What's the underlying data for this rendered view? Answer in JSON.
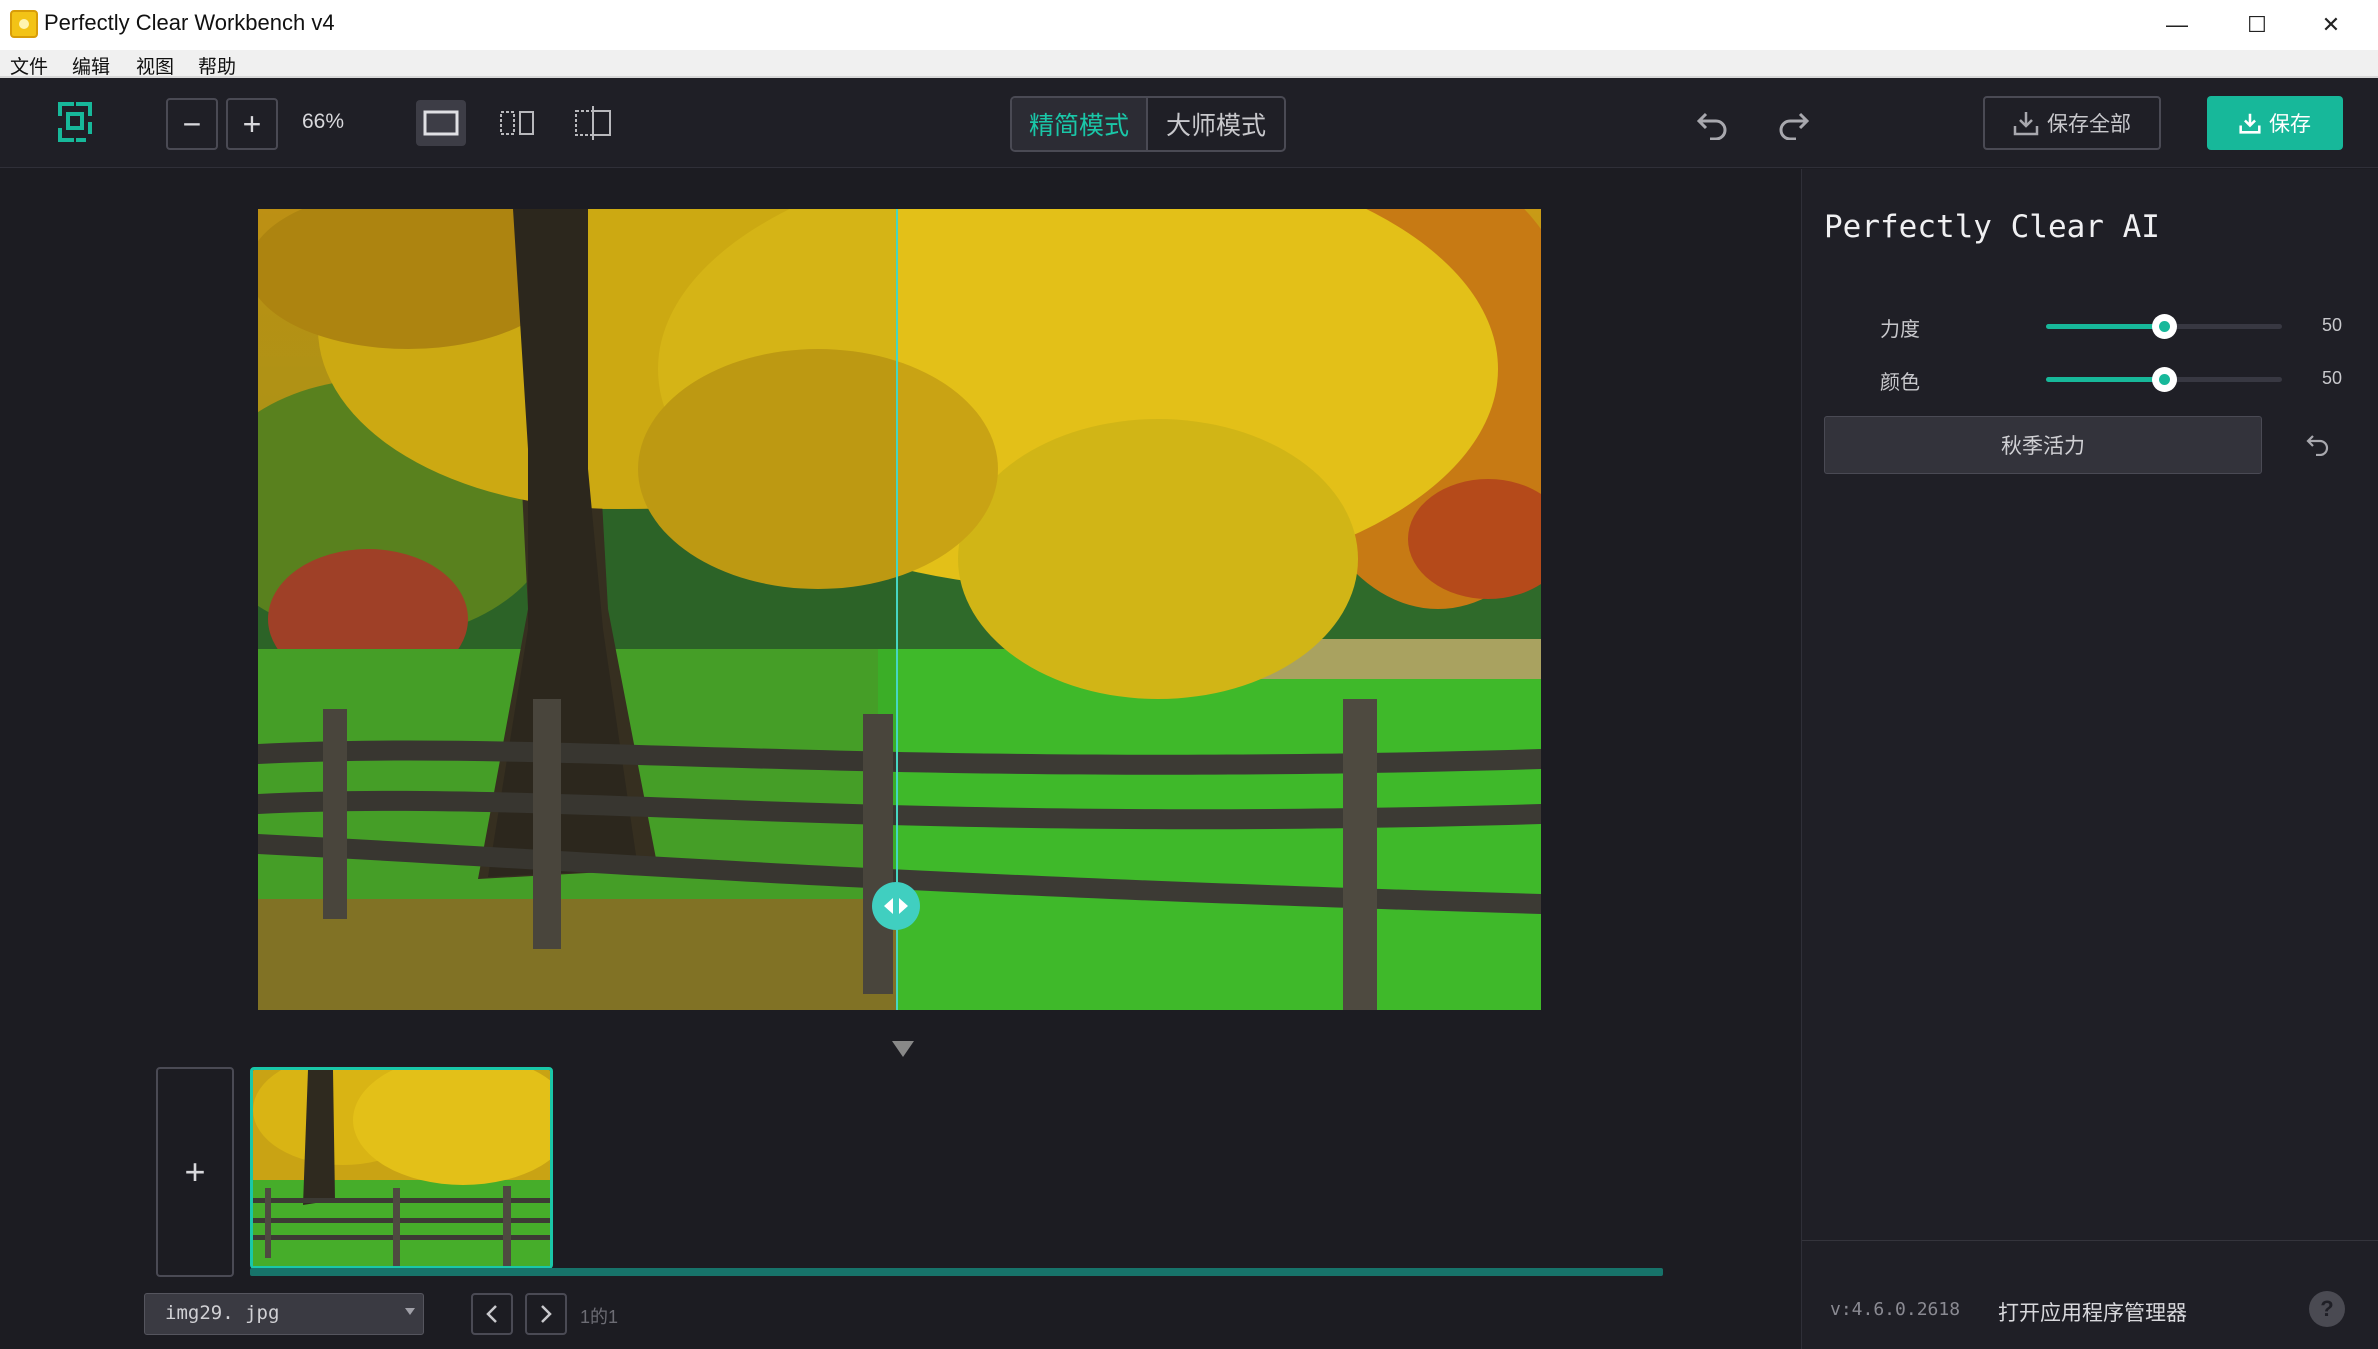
{
  "window": {
    "title": "Perfectly Clear Workbench v4",
    "minimize_glyph": "—",
    "maximize_glyph": "☐",
    "close_glyph": "✕"
  },
  "menu": [
    "文件",
    "编辑",
    "视图",
    "帮助"
  ],
  "toolbar": {
    "zoom_out_glyph": "−",
    "zoom_in_glyph": "+",
    "zoom_level": "66%",
    "modes": [
      {
        "label": "精简模式",
        "active": true
      },
      {
        "label": "大师模式",
        "active": false
      }
    ],
    "save_all_label": "保存全部",
    "save_label": "保存"
  },
  "canvas": {
    "add_glyph": "+",
    "filename": "img29. jpg",
    "page_info": "1的1"
  },
  "panel": {
    "title": "Perfectly Clear AI",
    "sliders": [
      {
        "label": "力度",
        "value": 50,
        "percent": 50
      },
      {
        "label": "颜色",
        "value": 50,
        "percent": 50
      }
    ],
    "preset_label": "秋季活力",
    "version": "v:4.6.0.2618",
    "app_manager_label": "打开应用程序管理器",
    "help_glyph": "?"
  },
  "colors": {
    "accent": "#17b89a",
    "background": "#1c1c22",
    "panel": "#1f1f26"
  }
}
